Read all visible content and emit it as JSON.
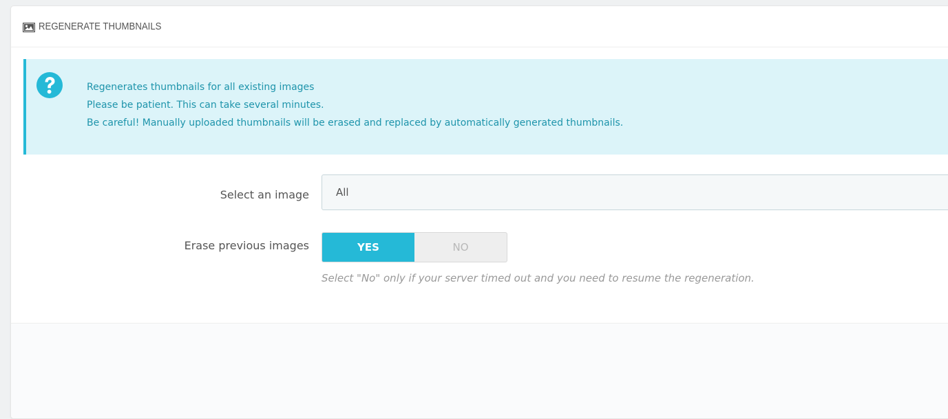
{
  "panel": {
    "title": "REGENERATE THUMBNAILS",
    "icon": "picture-icon"
  },
  "alert": {
    "icon": "question-icon",
    "lines": [
      "Regenerates thumbnails for all existing images",
      "Please be patient. This can take several minutes.",
      "Be careful! Manually uploaded thumbnails will be erased and replaced by automatically generated thumbnails."
    ],
    "color": "#1e94ab",
    "background": "#dcf4f9",
    "border_color": "#25b9d7"
  },
  "form": {
    "select_image": {
      "label": "Select an image",
      "value": "All"
    },
    "erase_previous": {
      "label": "Erase previous images",
      "yes_label": "YES",
      "no_label": "NO",
      "selected": "YES",
      "help": "Select \"No\" only if your server timed out and you need to resume the regeneration."
    }
  },
  "colors": {
    "accent": "#25b9d7",
    "label_text": "#555555",
    "help_text": "#999999"
  }
}
